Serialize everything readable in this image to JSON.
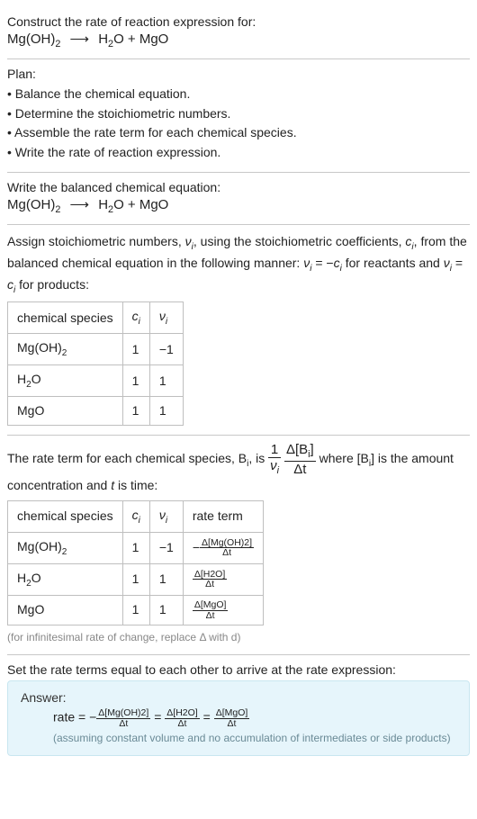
{
  "prompt": {
    "title": "Construct the rate of reaction expression for:",
    "reactant": "Mg(OH)",
    "reactant_sub": "2",
    "arrow": "⟶",
    "product1": "H",
    "product1_sub": "2",
    "product1_tail": "O",
    "plus": "+",
    "product2": "MgO"
  },
  "plan": {
    "heading": "Plan:",
    "b1": "• Balance the chemical equation.",
    "b2": "• Determine the stoichiometric numbers.",
    "b3": "• Assemble the rate term for each chemical species.",
    "b4": "• Write the rate of reaction expression."
  },
  "balanced": {
    "heading": "Write the balanced chemical equation:",
    "reactant": "Mg(OH)",
    "reactant_sub": "2",
    "arrow": "⟶",
    "product1": "H",
    "product1_sub": "2",
    "product1_tail": "O",
    "plus": "+",
    "product2": "MgO"
  },
  "stoich": {
    "intro1": "Assign stoichiometric numbers, ",
    "nu": "ν",
    "sub_i": "i",
    "intro2": ", using the stoichiometric coefficients, ",
    "c": "c",
    "intro3": ", from the balanced chemical equation in the following manner: ",
    "eq1_lhs": "ν",
    "eq1_mid": " = −",
    "eq1_rhs": "c",
    "intro4": " for reactants and ",
    "eq2_mid": " = ",
    "intro5": " for products:",
    "head_col1": "chemical species",
    "head_col2_c": "c",
    "head_col3_nu": "ν",
    "rows": [
      {
        "species_head": "Mg(OH)",
        "species_sub": "2",
        "c": "1",
        "nu": "−1"
      },
      {
        "species_head": "H",
        "species_sub": "2",
        "species_tail": "O",
        "c": "1",
        "nu": "1"
      },
      {
        "species_head": "MgO",
        "species_sub": "",
        "c": "1",
        "nu": "1"
      }
    ]
  },
  "rateterm": {
    "intro1": "The rate term for each chemical species, B",
    "intro2": ", is ",
    "frac1_num": "1",
    "frac1_den_sym": "ν",
    "frac2_num": "Δ[B",
    "frac2_num_tail": "]",
    "frac2_den": "Δt",
    "intro3": " where [B",
    "intro4": "] is the amount concentration and ",
    "t": "t",
    "intro5": " is time:",
    "head_col1": "chemical species",
    "head_col4": "rate term",
    "rows": [
      {
        "species_head": "Mg(OH)",
        "species_sub": "2",
        "c": "1",
        "nu": "−1",
        "neg": "−",
        "num": "Δ[Mg(OH)2]",
        "den": "Δt"
      },
      {
        "species_head": "H",
        "species_sub": "2",
        "species_tail": "O",
        "c": "1",
        "nu": "1",
        "neg": "",
        "num": "Δ[H2O]",
        "den": "Δt"
      },
      {
        "species_head": "MgO",
        "species_sub": "",
        "c": "1",
        "nu": "1",
        "neg": "",
        "num": "Δ[MgO]",
        "den": "Δt"
      }
    ],
    "footnote": "(for infinitesimal rate of change, replace Δ with d)"
  },
  "final": {
    "heading": "Set the rate terms equal to each other to arrive at the rate expression:"
  },
  "answer": {
    "label": "Answer:",
    "rate": "rate = ",
    "neg": "−",
    "eq": " = ",
    "t1_num": "Δ[Mg(OH)2]",
    "t2_num": "Δ[H2O]",
    "t3_num": "Δ[MgO]",
    "den": "Δt",
    "note": "(assuming constant volume and no accumulation of intermediates or side products)"
  },
  "chart_data": {
    "type": "table",
    "tables": [
      {
        "title": "Stoichiometric numbers",
        "columns": [
          "chemical species",
          "c_i",
          "nu_i"
        ],
        "rows": [
          [
            "Mg(OH)2",
            1,
            -1
          ],
          [
            "H2O",
            1,
            1
          ],
          [
            "MgO",
            1,
            1
          ]
        ]
      },
      {
        "title": "Rate terms",
        "columns": [
          "chemical species",
          "c_i",
          "nu_i",
          "rate term"
        ],
        "rows": [
          [
            "Mg(OH)2",
            1,
            -1,
            "-Δ[Mg(OH)2]/Δt"
          ],
          [
            "H2O",
            1,
            1,
            "Δ[H2O]/Δt"
          ],
          [
            "MgO",
            1,
            1,
            "Δ[MgO]/Δt"
          ]
        ]
      }
    ]
  }
}
